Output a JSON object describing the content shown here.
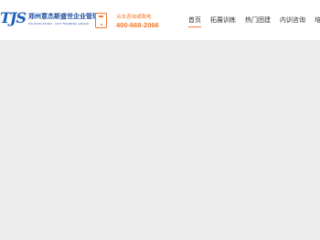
{
  "header": {
    "logo_mark": "TJS",
    "company_name": "郑州意杰斯盛世企业管理",
    "company_name_en": "TJS EDUCATION · OUT TRAINING GROUP",
    "phone_label": "点击咨询或致电",
    "phone_number": "400-668-2066"
  },
  "nav": {
    "items": [
      {
        "label": "首页",
        "active": true
      },
      {
        "label": "拓展训练",
        "active": false
      },
      {
        "label": "热门团建",
        "active": false
      },
      {
        "label": "内训咨询",
        "active": false
      },
      {
        "label": "培训",
        "active": false
      }
    ]
  },
  "colors": {
    "brand_orange": "#f0782a",
    "brand_blue": "#1d5fb8",
    "page_background": "#ededed"
  },
  "icons": [
    "phone-icon"
  ]
}
